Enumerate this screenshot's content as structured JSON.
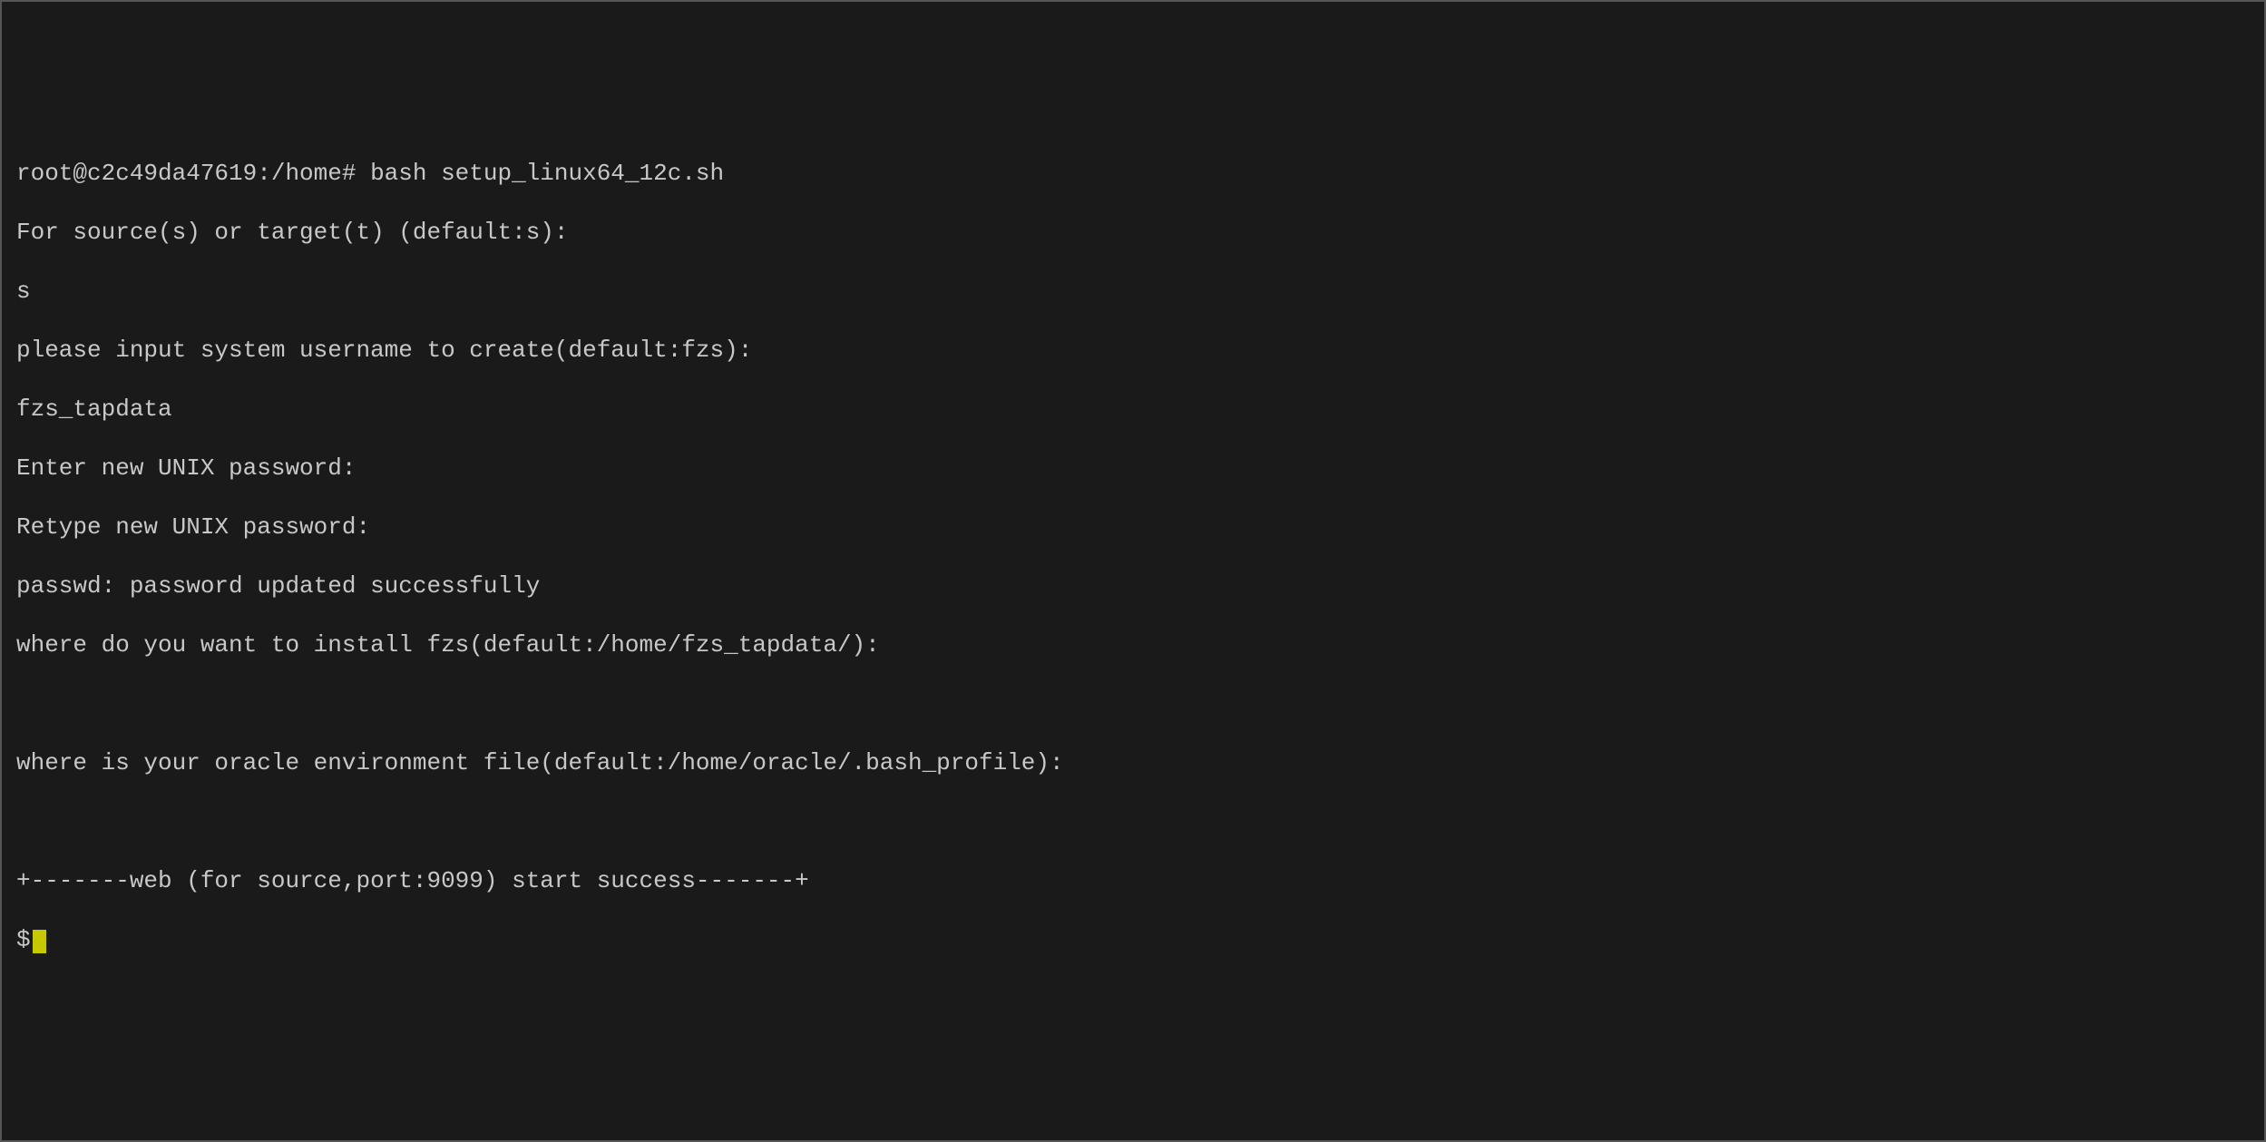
{
  "terminal": {
    "lines": [
      "root@c2c49da47619:/home# bash setup_linux64_12c.sh",
      "For source(s) or target(t) (default:s):",
      "s",
      "please input system username to create(default:fzs):",
      "fzs_tapdata",
      "Enter new UNIX password:",
      "Retype new UNIX password:",
      "passwd: password updated successfully",
      "where do you want to install fzs(default:/home/fzs_tapdata/):",
      "",
      "where is your oracle environment file(default:/home/oracle/.bash_profile):",
      "",
      "+-------web (for source,port:9099) start success-------+"
    ],
    "prompt_char": "$"
  }
}
